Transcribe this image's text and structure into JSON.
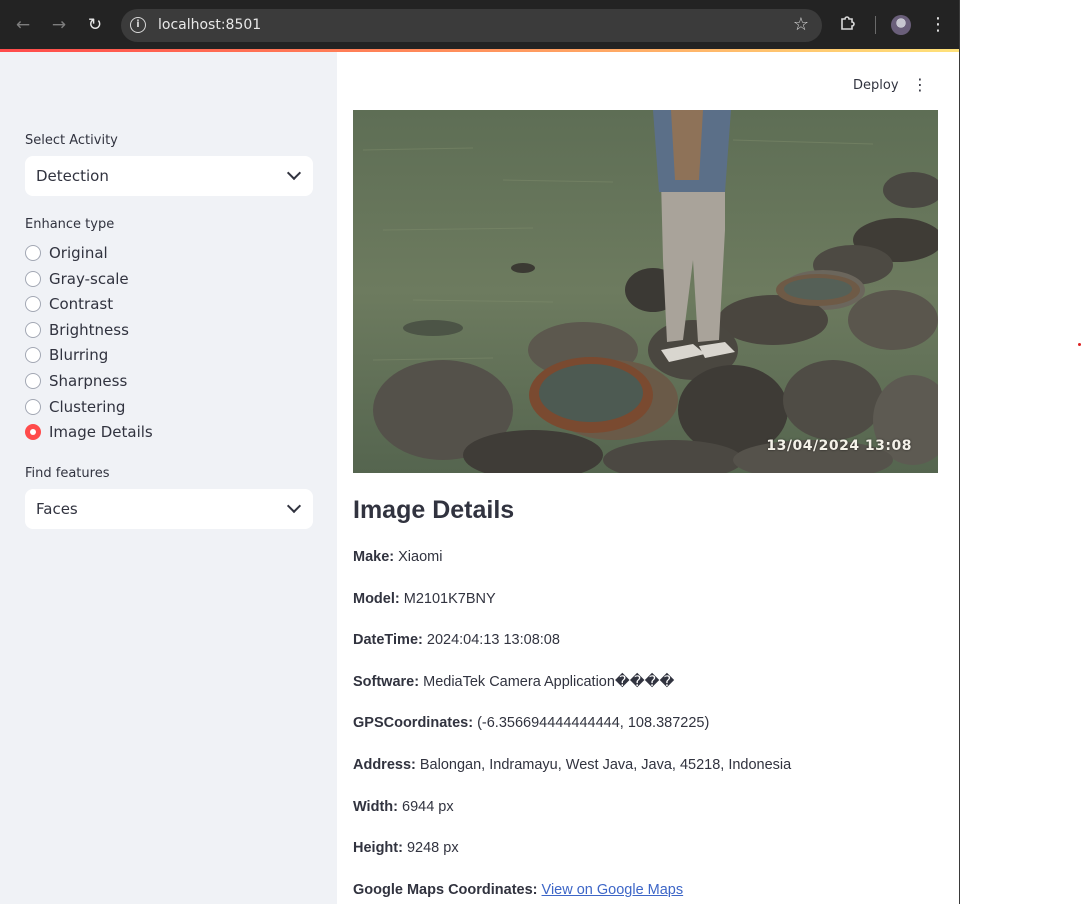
{
  "browser": {
    "url": "localhost:8501"
  },
  "app": {
    "deploy_label": "Deploy"
  },
  "sidebar": {
    "activity_label": "Select Activity",
    "activity_value": "Detection",
    "enhance_label": "Enhance type",
    "enhance_options": [
      {
        "label": "Original",
        "selected": false
      },
      {
        "label": "Gray-scale",
        "selected": false
      },
      {
        "label": "Contrast",
        "selected": false
      },
      {
        "label": "Brightness",
        "selected": false
      },
      {
        "label": "Blurring",
        "selected": false
      },
      {
        "label": "Sharpness",
        "selected": false
      },
      {
        "label": "Clustering",
        "selected": false
      },
      {
        "label": "Image Details",
        "selected": true
      }
    ],
    "features_label": "Find features",
    "features_value": "Faces"
  },
  "main": {
    "photo_timestamp": "13/04/2024  13:08",
    "heading": "Image Details",
    "details": [
      {
        "key": "Make:",
        "value": "Xiaomi"
      },
      {
        "key": "Model:",
        "value": "M2101K7BNY"
      },
      {
        "key": "DateTime:",
        "value": "2024:04:13 13:08:08"
      },
      {
        "key": "Software:",
        "value": "MediaTek Camera Application����"
      },
      {
        "key": "GPSCoordinates:",
        "value": "(-6.356694444444444, 108.387225)"
      },
      {
        "key": "Address:",
        "value": "Balongan, Indramayu, West Java, Java, 45218, Indonesia"
      },
      {
        "key": "Width:",
        "value": "6944 px"
      },
      {
        "key": "Height:",
        "value": "9248 px"
      }
    ],
    "maps_key": "Google Maps Coordinates:",
    "maps_link": "View on Google Maps"
  },
  "colors": {
    "accent": "#ff4b4b",
    "sidebar_bg": "#f0f2f6",
    "text": "#31333f",
    "link": "#3d66c7"
  }
}
